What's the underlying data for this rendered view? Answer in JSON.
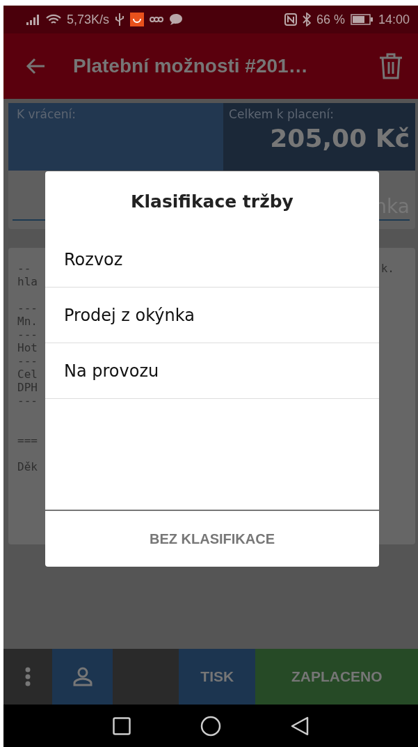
{
  "status_bar": {
    "speed": "5,73K/s",
    "battery": "66 %",
    "time": "14:00"
  },
  "app_bar": {
    "title": "Platební možnosti #201…"
  },
  "summary": {
    "change_label": "K vrácení:",
    "total_label": "Celkem k placení:",
    "total": "205,00 Kč"
  },
  "input_field": {
    "value_fragment": "nka"
  },
  "receipt": {
    "blocks": [
      [
        "--",
        "hla"
      ],
      [
        "---",
        "Mn.",
        "---",
        "Hot",
        "---",
        "Cel",
        "DPH",
        "---"
      ],
      [
        "==="
      ],
      [
        "Děk"
      ]
    ],
    "right_fragment": "k."
  },
  "dialog": {
    "title": "Klasifikace tržby",
    "options": [
      "Rozvoz",
      "Prodej z okýnka",
      "Na provozu"
    ],
    "button": "BEZ KLASIFIKACE"
  },
  "bottom_bar": [
    {
      "kind": "menu"
    },
    {
      "kind": "customer"
    },
    {
      "kind": "blank"
    },
    {
      "kind": "text",
      "label": "TISK",
      "color": "#1c3550"
    },
    {
      "kind": "text",
      "label": "ZAPLACENO",
      "color": "#264a26"
    }
  ]
}
